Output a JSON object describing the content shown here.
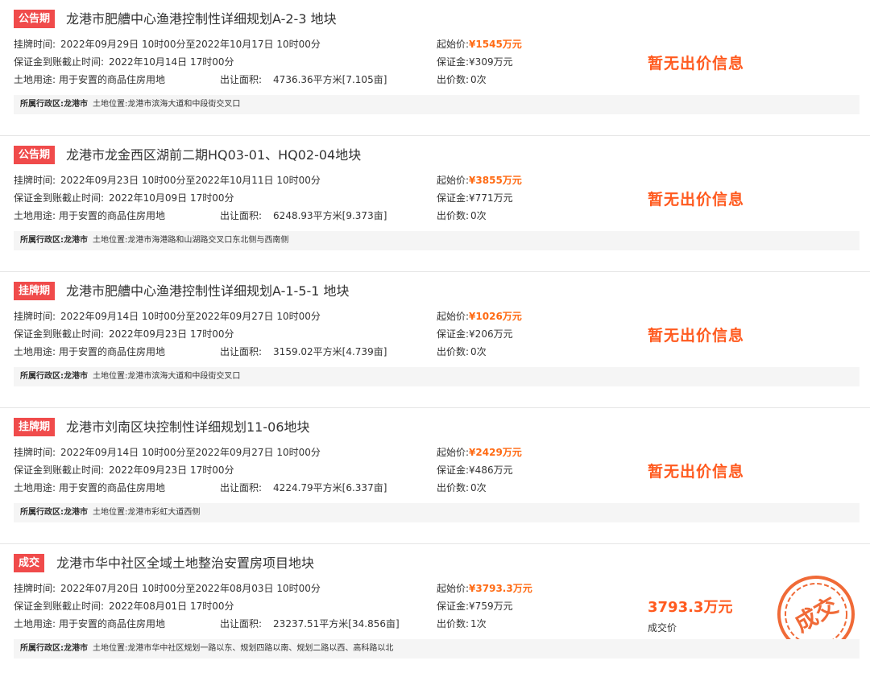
{
  "colors": {
    "status_notice": "#f04b4b",
    "status_listing": "#f04b4b",
    "status_deal": "#f04b4b",
    "accent_orange": "#ff6a13",
    "stamp_orange": "#f06a37"
  },
  "labels": {
    "listing_time": "挂牌时间:",
    "deposit_deadline": "保证金到账截止时间:",
    "land_use": "土地用途:",
    "area": "出让面积:",
    "start_price": "起始价:",
    "deposit": "保证金:",
    "bid_count": "出价数:",
    "district": "所属行政区:",
    "location": "土地位置:"
  },
  "listings": [
    {
      "status": "公告期",
      "title": "龙港市肥艚中心渔港控制性详细规划A-2-3 地块",
      "listing_time": "2022年09月29日 10时00分至2022年10月17日 10时00分",
      "deposit_deadline": "2022年10月14日 17时00分",
      "land_use": "用于安置的商品住房用地",
      "area": "4736.36平方米[7.105亩]",
      "start_price": "¥1545万元",
      "deposit": "¥309万元",
      "bid_count": "0次",
      "bid_info": "暂无出价信息",
      "district": "龙港市",
      "location": "龙港市滨海大道和中段街交叉口"
    },
    {
      "status": "公告期",
      "title": "龙港市龙金西区湖前二期HQ03-01、HQ02-04地块",
      "listing_time": "2022年09月23日 10时00分至2022年10月11日 10时00分",
      "deposit_deadline": "2022年10月09日 17时00分",
      "land_use": "用于安置的商品住房用地",
      "area": "6248.93平方米[9.373亩]",
      "start_price": "¥3855万元",
      "deposit": "¥771万元",
      "bid_count": "0次",
      "bid_info": "暂无出价信息",
      "district": "龙港市",
      "location": "龙港市海港路和山湖路交叉口东北侧与西南侧"
    },
    {
      "status": "挂牌期",
      "title": "龙港市肥艚中心渔港控制性详细规划A-1-5-1 地块",
      "listing_time": "2022年09月14日 10时00分至2022年09月27日 10时00分",
      "deposit_deadline": "2022年09月23日 17时00分",
      "land_use": "用于安置的商品住房用地",
      "area": "3159.02平方米[4.739亩]",
      "start_price": "¥1026万元",
      "deposit": "¥206万元",
      "bid_count": "0次",
      "bid_info": "暂无出价信息",
      "district": "龙港市",
      "location": "龙港市滨海大道和中段街交叉口"
    },
    {
      "status": "挂牌期",
      "title": "龙港市刘南区块控制性详细规划11-06地块",
      "listing_time": "2022年09月14日 10时00分至2022年09月27日 10时00分",
      "deposit_deadline": "2022年09月23日 17时00分",
      "land_use": "用于安置的商品住房用地",
      "area": "4224.79平方米[6.337亩]",
      "start_price": "¥2429万元",
      "deposit": "¥486万元",
      "bid_count": "0次",
      "bid_info": "暂无出价信息",
      "district": "龙港市",
      "location": "龙港市彩虹大道西侧"
    },
    {
      "status": "成交",
      "title": "龙港市华中社区全域土地整治安置房项目地块",
      "listing_time": "2022年07月20日 10时00分至2022年08月03日 10时00分",
      "deposit_deadline": "2022年08月01日 17时00分",
      "land_use": "用于安置的商品住房用地",
      "area": "23237.51平方米[34.856亩]",
      "start_price": "¥3793.3万元",
      "deposit": "¥759万元",
      "bid_count": "1次",
      "deal_price": "3793.3万元",
      "deal_caption": "成交价",
      "stamp_text": "成交",
      "district": "龙港市",
      "location": "龙港市华中社区规划一路以东、规划四路以南、规划二路以西、高科路以北"
    }
  ]
}
